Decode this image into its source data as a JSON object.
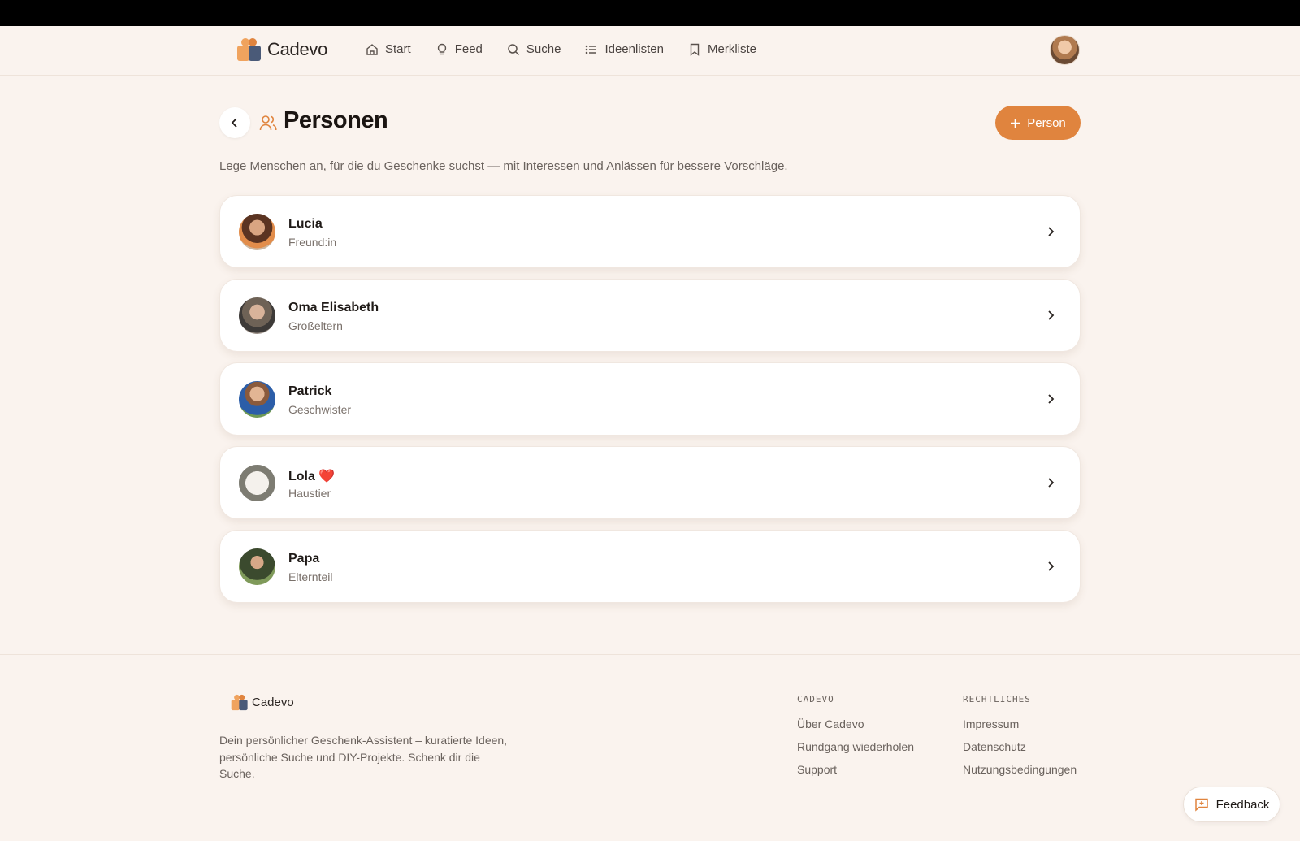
{
  "brand": {
    "name": "Cadevo"
  },
  "nav": {
    "items": [
      {
        "label": "Start",
        "icon": "home-icon"
      },
      {
        "label": "Feed",
        "icon": "lightbulb-icon"
      },
      {
        "label": "Suche",
        "icon": "search-icon"
      },
      {
        "label": "Ideenlisten",
        "icon": "list-icon"
      },
      {
        "label": "Merkliste",
        "icon": "bookmark-icon"
      }
    ]
  },
  "page": {
    "title": "Personen",
    "subtitle": "Lege Menschen an, für die du Geschenke suchst — mit Interessen und Anlässen für bessere Vorschläge.",
    "add_button": "Person"
  },
  "persons": [
    {
      "name": "Lucia",
      "relation": "Freund:in"
    },
    {
      "name": "Oma Elisabeth",
      "relation": "Großeltern"
    },
    {
      "name": "Patrick",
      "relation": "Geschwister"
    },
    {
      "name": "Lola ❤️",
      "relation": "Haustier"
    },
    {
      "name": "Papa",
      "relation": "Elternteil"
    }
  ],
  "footer": {
    "description": "Dein persönlicher Geschenk-Assistent – kuratierte Ideen, persönliche Suche und DIY-Projekte. Schenk dir die Suche.",
    "col1": {
      "title": "CADEVO",
      "links": [
        "Über Cadevo",
        "Rundgang wiederholen",
        "Support"
      ]
    },
    "col2": {
      "title": "RECHTLICHES",
      "links": [
        "Impressum",
        "Datenschutz",
        "Nutzungsbedingungen"
      ]
    }
  },
  "feedback": {
    "label": "Feedback"
  },
  "colors": {
    "accent": "#e0843e",
    "background": "#faf3ee",
    "brand_dark": "#4a5a78"
  }
}
